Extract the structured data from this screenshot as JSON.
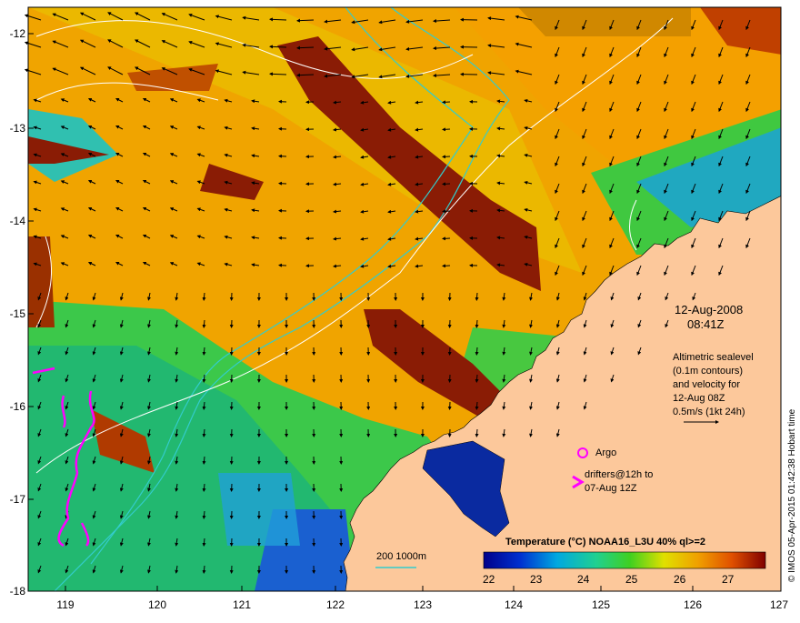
{
  "map": {
    "date": "12-Aug-2008",
    "time": "08:41Z",
    "altimetry_lines": [
      "Altimetric sealevel",
      "(0.1m contours)",
      "and velocity for",
      "12-Aug 08Z",
      "0.5m/s (1kt 24h)"
    ],
    "argo_label": "Argo",
    "drifters_line1": "drifters@12h to",
    "drifters_line2": "07-Aug 12Z",
    "isobath_label": "200  1000m",
    "colorbar_title": "Temperature (°C) NOAA16_L3U 40% ql>=2",
    "colorbar_ticks": [
      "22",
      "23",
      "24",
      "25",
      "26",
      "27"
    ],
    "credit": "© IMOS 05-Apr-2015 01:42:38 Hobart time",
    "lat_labels": [
      "-12",
      "-13",
      "-14",
      "-15",
      "-16",
      "-17",
      "-18"
    ],
    "lon_labels": [
      "119",
      "120",
      "121",
      "122",
      "123",
      "124",
      "125",
      "126",
      "127"
    ],
    "colors": {
      "land": "#fcc89b",
      "warm": "#f0a000",
      "hot": "#8a1c05",
      "cool": "#33c85a",
      "cold": "#0a2aa0",
      "drifter": "#ff00ff",
      "isobath": "#33cccc",
      "contour": "#ffffff"
    }
  }
}
